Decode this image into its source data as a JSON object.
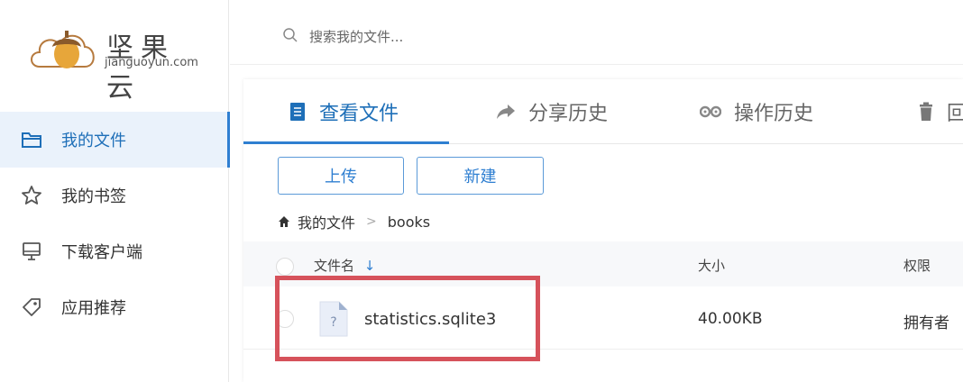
{
  "brand": {
    "name_cn": "坚果云",
    "name_en": "jianguoyun.com"
  },
  "sidebar": {
    "items": [
      {
        "label": "我的文件",
        "icon": "folder-icon",
        "active": true
      },
      {
        "label": "我的书签",
        "icon": "star-icon",
        "active": false
      },
      {
        "label": "下载客户端",
        "icon": "monitor-icon",
        "active": false
      },
      {
        "label": "应用推荐",
        "icon": "tag-icon",
        "active": false
      }
    ]
  },
  "search": {
    "placeholder": "搜索我的文件..."
  },
  "tabs": [
    {
      "label": "查看文件",
      "icon": "document-icon",
      "active": true
    },
    {
      "label": "分享历史",
      "icon": "share-icon",
      "active": false
    },
    {
      "label": "操作历史",
      "icon": "history-icon",
      "active": false
    },
    {
      "label": "回",
      "icon": "trash-icon",
      "active": false
    }
  ],
  "toolbar": {
    "upload_label": "上传",
    "new_label": "新建"
  },
  "breadcrumb": {
    "root": "我的文件",
    "separator": ">",
    "current": "books"
  },
  "table": {
    "columns": {
      "name": "文件名",
      "size": "大小",
      "permission": "权限"
    },
    "rows": [
      {
        "name": "statistics.sqlite3",
        "size": "40.00KB",
        "permission": "拥有者",
        "icon_glyph": "?"
      }
    ]
  },
  "colors": {
    "accent": "#2f7fd1",
    "highlight": "#d6525b"
  }
}
